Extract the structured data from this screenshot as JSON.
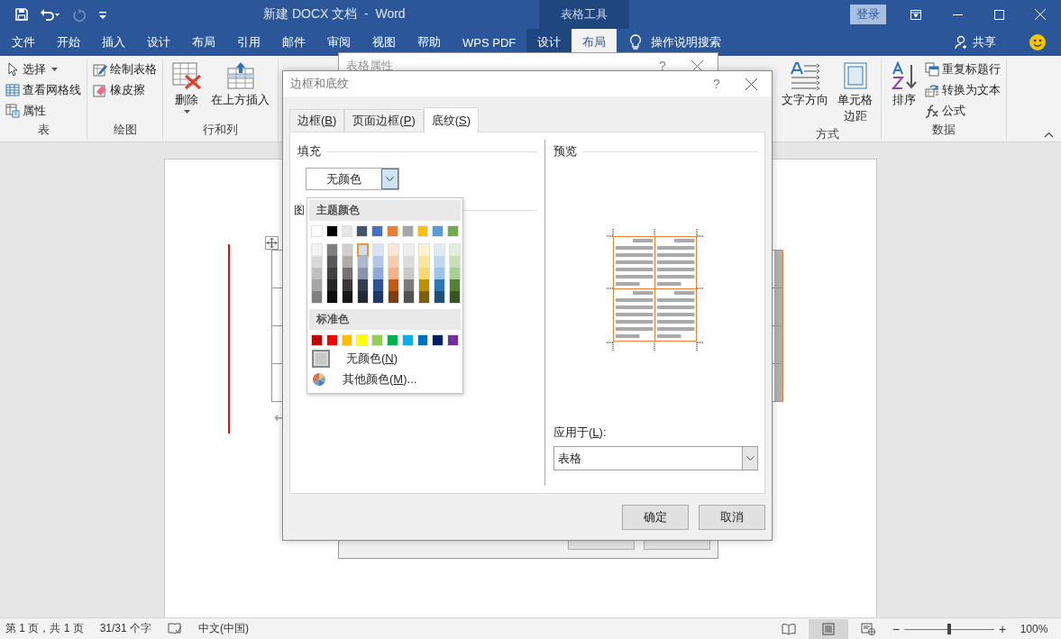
{
  "title_bar": {
    "title": "新建 DOCX 文档  -  Word",
    "context_group": "表格工具",
    "sign_in": "登录"
  },
  "quick_access": [
    {
      "kind": "save",
      "disabled": false
    },
    {
      "kind": "undo",
      "disabled": false
    },
    {
      "kind": "redo",
      "disabled": true
    },
    {
      "kind": "customize",
      "disabled": false
    }
  ],
  "ribbon_tabs": [
    {
      "label": "文件",
      "selected": false,
      "contextual": false
    },
    {
      "label": "开始",
      "selected": false,
      "contextual": false
    },
    {
      "label": "插入",
      "selected": false,
      "contextual": false
    },
    {
      "label": "设计",
      "selected": false,
      "contextual": false
    },
    {
      "label": "布局",
      "selected": false,
      "contextual": false
    },
    {
      "label": "引用",
      "selected": false,
      "contextual": false
    },
    {
      "label": "邮件",
      "selected": false,
      "contextual": false
    },
    {
      "label": "审阅",
      "selected": false,
      "contextual": false
    },
    {
      "label": "视图",
      "selected": false,
      "contextual": false
    },
    {
      "label": "帮助",
      "selected": false,
      "contextual": false
    },
    {
      "label": "WPS PDF",
      "selected": false,
      "contextual": false
    },
    {
      "label": "设计",
      "selected": false,
      "contextual": true
    },
    {
      "label": "布局",
      "selected": true,
      "contextual": true
    }
  ],
  "tell_me": "操作说明搜索",
  "share": "共享",
  "ribbon_left": [
    {
      "label": "表",
      "items": [
        {
          "kind": "select",
          "label": "选择",
          "large": false,
          "dropdown": true
        },
        {
          "kind": "gridlines",
          "label": "查看网格线",
          "large": false,
          "dropdown": false
        },
        {
          "kind": "properties",
          "label": "属性",
          "large": false,
          "dropdown": false
        }
      ]
    },
    {
      "label": "绘图",
      "items": [
        {
          "kind": "draw",
          "label": "绘制表格",
          "large": false,
          "dropdown": false
        },
        {
          "kind": "eraser",
          "label": "橡皮擦",
          "large": false,
          "dropdown": false
        }
      ]
    },
    {
      "label": "行和列",
      "items": [
        {
          "kind": "delete",
          "label": "删除",
          "large": true,
          "dropdown": true
        },
        {
          "kind": "insertabove",
          "label": "在上方插入",
          "large": true,
          "dropdown": false
        }
      ]
    }
  ],
  "ribbon_right": [
    {
      "label": "方式",
      "items": [
        {
          "kind": "textdirection",
          "label": "文字方向",
          "large": true,
          "dropdown": false
        },
        {
          "kind": "margins",
          "label": "单元格边距",
          "large": true,
          "dropdown": false
        }
      ]
    },
    {
      "label": "数据",
      "items": [
        {
          "kind": "sort",
          "label": "排序",
          "large": true,
          "dropdown": false
        },
        {
          "kind": "repeat",
          "label": "重复标题行",
          "large": false,
          "dropdown": false
        },
        {
          "kind": "convert",
          "label": "转换为文本",
          "large": false,
          "dropdown": false
        },
        {
          "kind": "formula",
          "label": "公式",
          "large": false,
          "dropdown": false
        }
      ]
    }
  ],
  "document": {
    "paragraph_mark": "↵"
  },
  "back_dialog": {
    "title": "表格属性",
    "help": "?"
  },
  "dialog": {
    "title": "边框和底纹",
    "help": "?",
    "tabs": [
      {
        "text": "边框(",
        "key": "B",
        "tail": ")",
        "selected": false
      },
      {
        "text": "页面边框(",
        "key": "P",
        "tail": ")",
        "selected": false
      },
      {
        "text": "底纹(",
        "key": "S",
        "tail": ")",
        "selected": true
      }
    ],
    "fill": {
      "label": "填充",
      "value": "无颜色"
    },
    "pattern_label": "图",
    "color_menu": {
      "theme_header": "主题颜色",
      "standard_header": "标准色",
      "theme_colors": [
        {
          "color": "#ffffff",
          "selected": false,
          "shades": [
            {
              "color": "#f2f2f2",
              "selected": false
            },
            {
              "color": "#d9d9d9",
              "selected": false
            },
            {
              "color": "#bfbfbf",
              "selected": false
            },
            {
              "color": "#a6a6a6",
              "selected": false
            },
            {
              "color": "#808080",
              "selected": false
            }
          ]
        },
        {
          "color": "#000000",
          "selected": false,
          "shades": [
            {
              "color": "#7f7f7f",
              "selected": false
            },
            {
              "color": "#595959",
              "selected": false
            },
            {
              "color": "#404040",
              "selected": false
            },
            {
              "color": "#262626",
              "selected": false
            },
            {
              "color": "#0d0d0d",
              "selected": false
            }
          ]
        },
        {
          "color": "#e7e6e6",
          "selected": false,
          "shades": [
            {
              "color": "#d0cece",
              "selected": false
            },
            {
              "color": "#aeabab",
              "selected": false
            },
            {
              "color": "#757171",
              "selected": false
            },
            {
              "color": "#3b3838",
              "selected": false
            },
            {
              "color": "#171616",
              "selected": false
            }
          ]
        },
        {
          "color": "#44546a",
          "selected": false,
          "shades": [
            {
              "color": "#d6dce4",
              "selected": true
            },
            {
              "color": "#adb9ca",
              "selected": false
            },
            {
              "color": "#8496b0",
              "selected": false
            },
            {
              "color": "#333f4f",
              "selected": false
            },
            {
              "color": "#222a35",
              "selected": false
            }
          ]
        },
        {
          "color": "#4472c4",
          "selected": false,
          "shades": [
            {
              "color": "#d9e2f3",
              "selected": false
            },
            {
              "color": "#b4c6e7",
              "selected": false
            },
            {
              "color": "#8eaadb",
              "selected": false
            },
            {
              "color": "#2f5496",
              "selected": false
            },
            {
              "color": "#1f3864",
              "selected": false
            }
          ]
        },
        {
          "color": "#ed7d31",
          "selected": false,
          "shades": [
            {
              "color": "#fbe5d5",
              "selected": false
            },
            {
              "color": "#f7caac",
              "selected": false
            },
            {
              "color": "#f4b183",
              "selected": false
            },
            {
              "color": "#c55a11",
              "selected": false
            },
            {
              "color": "#833c0b",
              "selected": false
            }
          ]
        },
        {
          "color": "#a5a5a5",
          "selected": false,
          "shades": [
            {
              "color": "#ededed",
              "selected": false
            },
            {
              "color": "#dbdbdb",
              "selected": false
            },
            {
              "color": "#c9c9c9",
              "selected": false
            },
            {
              "color": "#7b7b7b",
              "selected": false
            },
            {
              "color": "#525252",
              "selected": false
            }
          ]
        },
        {
          "color": "#ffc000",
          "selected": false,
          "shades": [
            {
              "color": "#fff2cc",
              "selected": false
            },
            {
              "color": "#ffe699",
              "selected": false
            },
            {
              "color": "#ffd966",
              "selected": false
            },
            {
              "color": "#bf9000",
              "selected": false
            },
            {
              "color": "#7f6000",
              "selected": false
            }
          ]
        },
        {
          "color": "#5b9bd5",
          "selected": false,
          "shades": [
            {
              "color": "#deebf6",
              "selected": false
            },
            {
              "color": "#bdd7ee",
              "selected": false
            },
            {
              "color": "#9dc3e6",
              "selected": false
            },
            {
              "color": "#2e75b5",
              "selected": false
            },
            {
              "color": "#1e4e79",
              "selected": false
            }
          ]
        },
        {
          "color": "#70ad47",
          "selected": false,
          "shades": [
            {
              "color": "#e2efd9",
              "selected": false
            },
            {
              "color": "#c5e0b3",
              "selected": false
            },
            {
              "color": "#a8d08d",
              "selected": false
            },
            {
              "color": "#538135",
              "selected": false
            },
            {
              "color": "#375623",
              "selected": false
            }
          ]
        }
      ],
      "standard_colors": [
        {
          "color": "#c00000",
          "selected": false
        },
        {
          "color": "#ff0000",
          "selected": false
        },
        {
          "color": "#ffc000",
          "selected": false
        },
        {
          "color": "#ffff00",
          "selected": false
        },
        {
          "color": "#92d050",
          "selected": false
        },
        {
          "color": "#00b050",
          "selected": false
        },
        {
          "color": "#00b0f0",
          "selected": false
        },
        {
          "color": "#0070c0",
          "selected": false
        },
        {
          "color": "#002060",
          "selected": false
        },
        {
          "color": "#7030a0",
          "selected": false
        }
      ],
      "no_color": {
        "text": "无颜色(",
        "key": "N",
        "tail": ")"
      },
      "more_colors": {
        "text": "其他颜色(",
        "key": "M",
        "tail": ")..."
      }
    },
    "preview": {
      "label": "预览"
    },
    "apply_to": {
      "text": "应用于(",
      "key": "L",
      "tail": "):",
      "value": "表格"
    },
    "buttons": [
      "确定",
      "取消"
    ]
  },
  "status_bar": {
    "left": [
      {
        "kind": "text",
        "label": "第 1 页，共 1 页"
      },
      {
        "kind": "text",
        "label": "31/31 个字"
      },
      {
        "kind": "proofing"
      },
      {
        "kind": "text",
        "label": "中文(中国)"
      }
    ],
    "views": [
      {
        "kind": "read",
        "selected": false
      },
      {
        "kind": "print",
        "selected": true
      },
      {
        "kind": "web",
        "selected": false
      }
    ],
    "zoom_out": "−",
    "zoom_in": "+",
    "zoom": {
      "level": 0.5,
      "value": "100%"
    }
  }
}
